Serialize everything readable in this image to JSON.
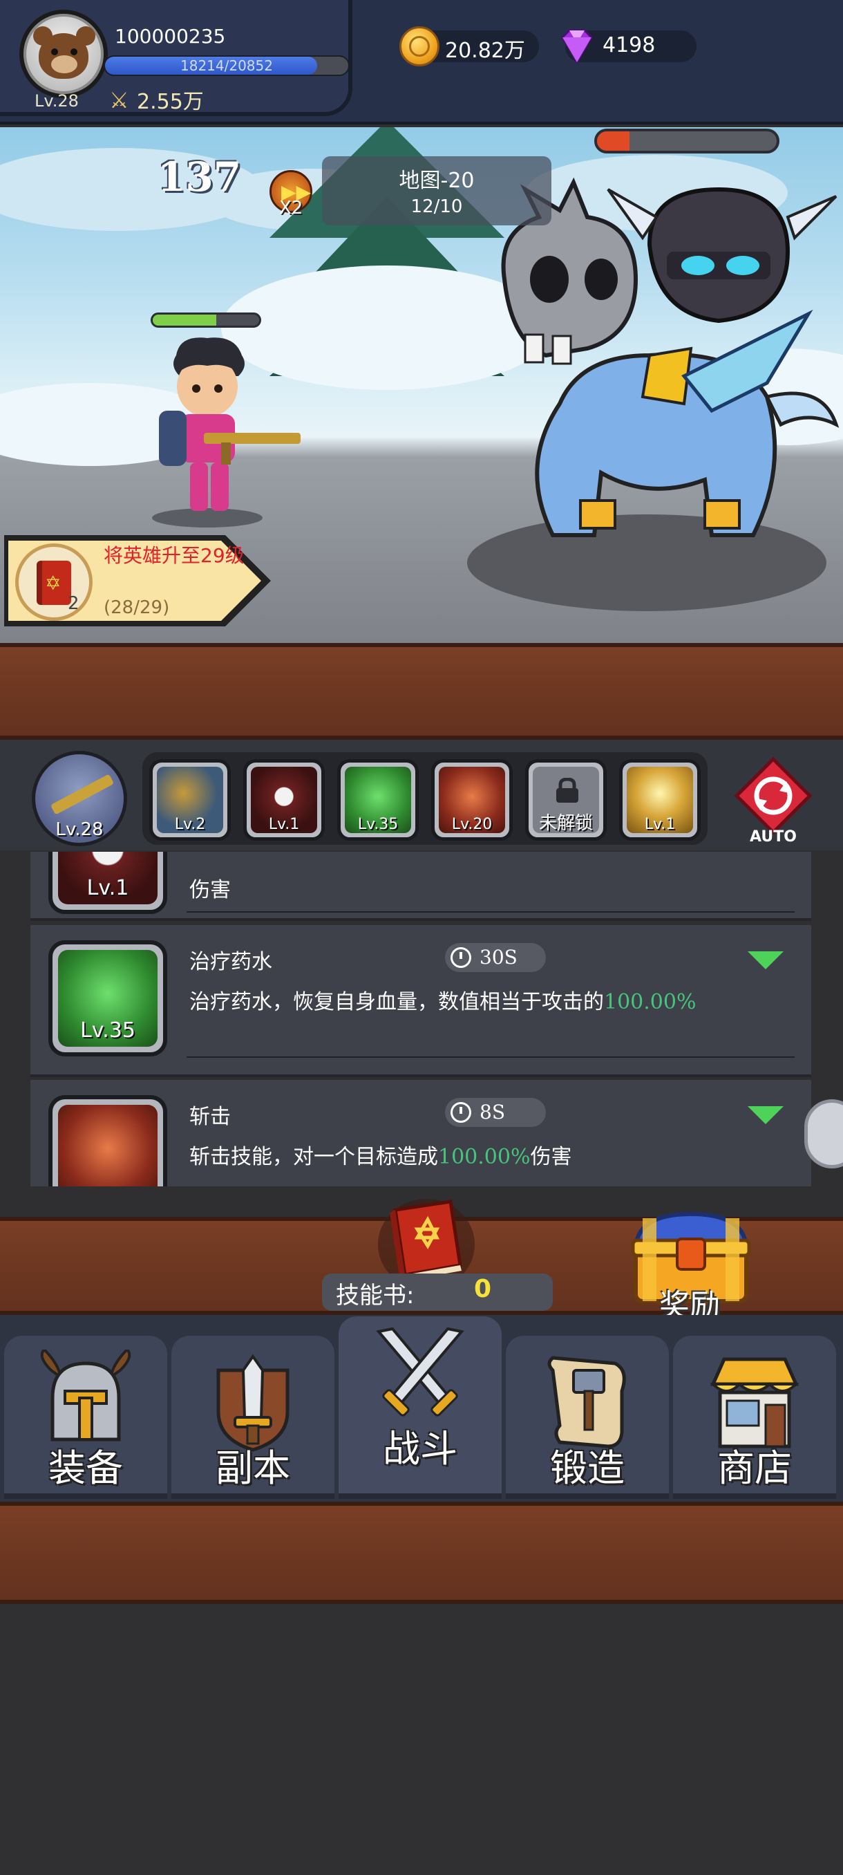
{
  "player": {
    "id": "100000235",
    "level": "Lv.28",
    "xp": "18214/20852",
    "xp_fraction": 0.873,
    "power": "2.55万"
  },
  "resources": {
    "gold": "20.82万",
    "gems": "4198"
  },
  "battle": {
    "combo": "137",
    "speed": "X2",
    "map_title": "地图-20",
    "map_progress": "12/10",
    "boss_hp_fraction": 0.18,
    "hero_hp_fraction": 0.6
  },
  "quest": {
    "title": "将英雄升至29级",
    "progress": "(28/29)",
    "reward_count": "2"
  },
  "skill_bar": {
    "weapon_level": "Lv.28",
    "slots": [
      {
        "name": "skill-slot-1",
        "level": "Lv.2",
        "color": "#3d5a78"
      },
      {
        "name": "skill-slot-2",
        "level": "Lv.1",
        "color": "#6b2020"
      },
      {
        "name": "skill-slot-3",
        "level": "Lv.35",
        "color": "#2f8a2f"
      },
      {
        "name": "skill-slot-4",
        "level": "Lv.20",
        "color": "#8a2a1c"
      }
    ],
    "locked_label": "未解锁",
    "slot6_level": "Lv.1",
    "auto_label": "AUTO"
  },
  "skill_list": {
    "partial_card": {
      "level": "Lv.1",
      "desc_tail": "伤害"
    },
    "cards": [
      {
        "title": "治疗药水",
        "cooldown": "30S",
        "desc_prefix": "治疗药水，恢复自身血量，数值相当于攻击的",
        "desc_value": "100.00%",
        "desc_suffix": "",
        "level": "Lv.35"
      },
      {
        "title": "斩击",
        "cooldown": "8S",
        "desc_prefix": "斩击技能，对一个目标造成",
        "desc_value": "100.00%",
        "desc_suffix": "伤害",
        "level": ""
      }
    ]
  },
  "rewards": {
    "skillbook_label": "技能书:",
    "skillbook_count": "0",
    "reward_label": "奖励"
  },
  "nav": {
    "tabs": [
      {
        "label": "装备"
      },
      {
        "label": "副本"
      },
      {
        "label": "战斗"
      },
      {
        "label": "锻造"
      },
      {
        "label": "商店"
      }
    ]
  },
  "colors": {
    "highlight_green": "#46c47a",
    "quest_red": "#e0202a",
    "skillbook_yellow": "#f7e13a"
  }
}
